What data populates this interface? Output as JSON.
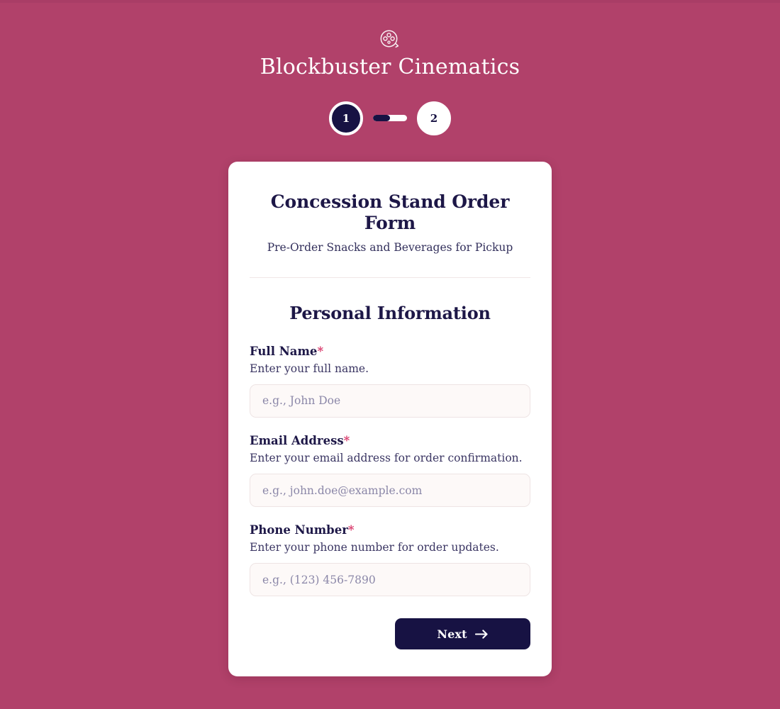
{
  "theme": {
    "page_background": "#b1416a",
    "card_background": "#ffffff",
    "accent_navy": "#171243",
    "required_star": "#d93a6b",
    "input_background": "#fdf9f8",
    "placeholder_color": "#8b87a8"
  },
  "brand": {
    "icon": "film-reel-icon",
    "name": "Blockbuster Cinematics"
  },
  "stepper": {
    "steps": [
      {
        "number": "1",
        "state": "active"
      },
      {
        "number": "2",
        "state": "inactive"
      }
    ],
    "connector_fill_percent": 50
  },
  "form": {
    "title": "Concession Stand Order Form",
    "subtitle": "Pre-Order Snacks and Beverages for Pickup",
    "section_title": "Personal Information",
    "fields": [
      {
        "label": "Full Name",
        "required_marker": "*",
        "hint": "Enter your full name.",
        "placeholder": "e.g., John Doe",
        "value": ""
      },
      {
        "label": "Email Address",
        "required_marker": "*",
        "hint": "Enter your email address for order confirmation.",
        "placeholder": "e.g., john.doe@example.com",
        "value": ""
      },
      {
        "label": "Phone Number",
        "required_marker": "*",
        "hint": "Enter your phone number for order updates.",
        "placeholder": "e.g., (123) 456-7890",
        "value": ""
      }
    ],
    "next_button": {
      "label": "Next",
      "icon": "arrow-right-icon"
    }
  }
}
